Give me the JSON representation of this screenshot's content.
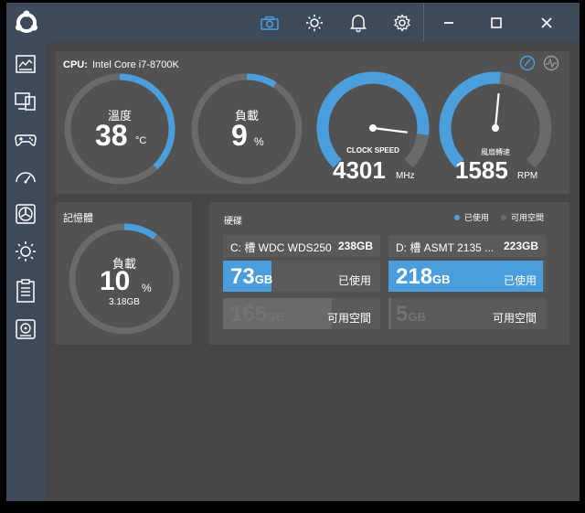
{
  "titlebar": {
    "icons": [
      "camera-icon",
      "brightness-icon",
      "bell-icon",
      "gear-icon"
    ],
    "window_controls": [
      "minimize",
      "maximize",
      "close"
    ]
  },
  "sidebar": {
    "items": [
      "dashboard-icon",
      "monitor-icon",
      "gamepad-icon",
      "speedometer-icon",
      "fan-icon",
      "light-icon",
      "clipboard-icon",
      "storage-icon"
    ]
  },
  "cpu": {
    "label": "CPU:",
    "model": "Intel Core i7-8700K",
    "temperature": {
      "title": "溫度",
      "value": "38",
      "unit": "°C",
      "percent": 0.38
    },
    "load": {
      "title": "負載",
      "value": "9",
      "unit": "%",
      "percent": 0.09
    },
    "clock": {
      "title": "CLOCK SPEED",
      "value": "4301",
      "unit": "MHz",
      "percent": 0.86
    },
    "fan": {
      "title": "風扇轉速",
      "value": "1585",
      "unit": "RPM",
      "percent": 0.52
    }
  },
  "memory": {
    "title": "記憶體",
    "load_title": "負載",
    "value": "10",
    "unit": "%",
    "used": "3.18GB",
    "percent": 0.1
  },
  "disk": {
    "title": "硬碟",
    "legend_used": "已使用",
    "legend_free": "可用空間",
    "colors": {
      "used": "#4a9edb",
      "free": "#6a6a6a"
    },
    "drives": [
      {
        "name": "C: 槽 WDC WDS250",
        "total": "238GB",
        "used_value": "73",
        "used_unit": "GB",
        "used_label": "已使用",
        "used_fraction": 0.31,
        "free_value": "165",
        "free_unit": "GB",
        "free_label": "可用空間",
        "free_fraction": 0.69
      },
      {
        "name": "D: 槽 ASMT 2135 ...",
        "total": "223GB",
        "used_value": "218",
        "used_unit": "GB",
        "used_label": "已使用",
        "used_fraction": 0.98,
        "free_value": "5",
        "free_unit": "GB",
        "free_label": "可用空間",
        "free_fraction": 0.02
      }
    ]
  }
}
